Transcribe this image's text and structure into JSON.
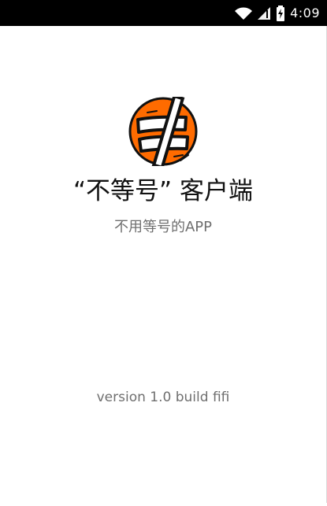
{
  "status_bar": {
    "time": "4:09",
    "icons": [
      "wifi-icon",
      "signal-icon",
      "battery-charging-icon"
    ]
  },
  "splash": {
    "title": "“不等号” 客户端",
    "subtitle": "不用等号的APP",
    "version": "version 1.0 build fifi",
    "logo_icon": "not-equal-logo-icon"
  },
  "colors": {
    "status_bar_background": "#000000",
    "screen_background": "#ffffff",
    "logo_orange": "#ff6b00",
    "title_text": "#111111",
    "secondary_text": "#6f6f6f"
  }
}
